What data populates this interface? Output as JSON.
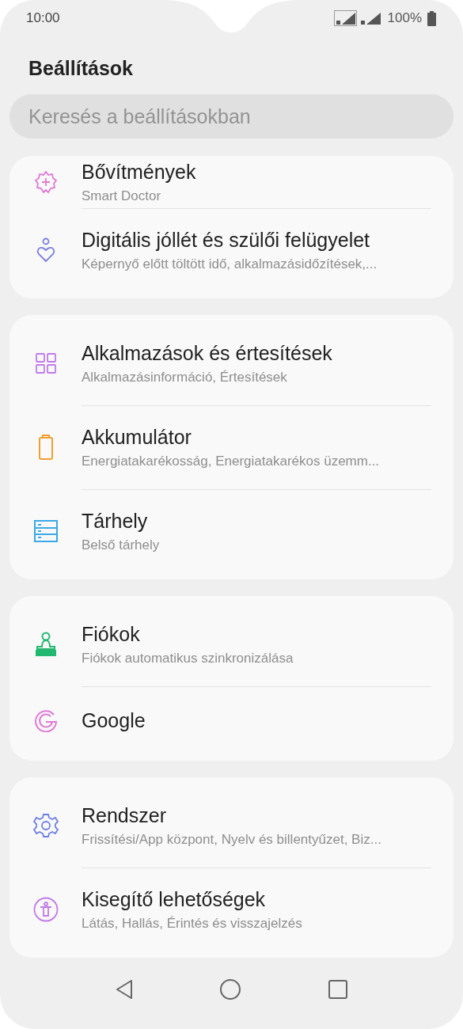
{
  "status_bar": {
    "time": "10:00",
    "battery": "100%"
  },
  "title": "Beállítások",
  "search": {
    "placeholder": "Keresés a beállításokban"
  },
  "groups": [
    {
      "items": [
        {
          "title": "Bővítmények",
          "subtitle": "Smart Doctor"
        },
        {
          "title": "Digitális jóllét és szülői felügyelet",
          "subtitle": "Képernyő előtt töltött idő, alkalmazásidőzítések,..."
        }
      ]
    },
    {
      "items": [
        {
          "title": "Alkalmazások és értesítések",
          "subtitle": "Alkalmazásinformáció, Értesítések"
        },
        {
          "title": "Akkumulátor",
          "subtitle": "Energiatakarékosság, Energiatakarékos üzemm..."
        },
        {
          "title": "Tárhely",
          "subtitle": "Belső tárhely"
        }
      ]
    },
    {
      "items": [
        {
          "title": "Fiókok",
          "subtitle": "Fiókok automatikus szinkronizálása"
        },
        {
          "title": "Google"
        }
      ]
    },
    {
      "items": [
        {
          "title": "Rendszer",
          "subtitle": "Frissítési/App központ, Nyelv és billentyűzet, Biz..."
        },
        {
          "title": "Kisegítő lehetőségek",
          "subtitle": "Látás, Hallás, Érintés és visszajelzés"
        }
      ]
    }
  ]
}
